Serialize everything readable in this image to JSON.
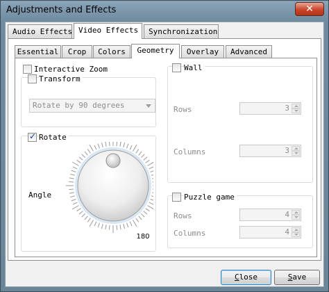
{
  "window": {
    "title": "Adjustments and Effects",
    "close_glyph": "✕"
  },
  "main_tabs": [
    {
      "label": "Audio Effects",
      "active": false
    },
    {
      "label": "Video Effects",
      "active": true
    },
    {
      "label": "Synchronization",
      "active": false
    }
  ],
  "sub_tabs": [
    {
      "label": "Essential",
      "active": false
    },
    {
      "label": "Crop",
      "active": false
    },
    {
      "label": "Colors",
      "active": false
    },
    {
      "label": "Geometry",
      "active": true
    },
    {
      "label": "Overlay",
      "active": false
    },
    {
      "label": "Advanced",
      "active": false
    }
  ],
  "geometry": {
    "interactive_zoom": {
      "label": "Interactive Zoom",
      "checked": false
    },
    "transform": {
      "label": "Transform",
      "checked": false,
      "combo_value": "Rotate by 90 degrees"
    },
    "rotate": {
      "label": "Rotate",
      "checked": true,
      "angle_label": "Angle",
      "dial_value_label": "180"
    },
    "wall": {
      "label": "Wall",
      "checked": false,
      "rows_label": "Rows",
      "rows_value": "3",
      "columns_label": "Columns",
      "columns_value": "3"
    },
    "puzzle": {
      "label": "Puzzle game",
      "checked": false,
      "rows_label": "Rows",
      "rows_value": "4",
      "columns_label": "Columns",
      "columns_value": "4"
    }
  },
  "footer": {
    "close_first": "C",
    "close_rest": "lose",
    "save_first": "S",
    "save_rest": "ave"
  },
  "icons": {
    "checkbox_checked": "check-icon",
    "combo_arrow": "chevron-down-icon"
  }
}
